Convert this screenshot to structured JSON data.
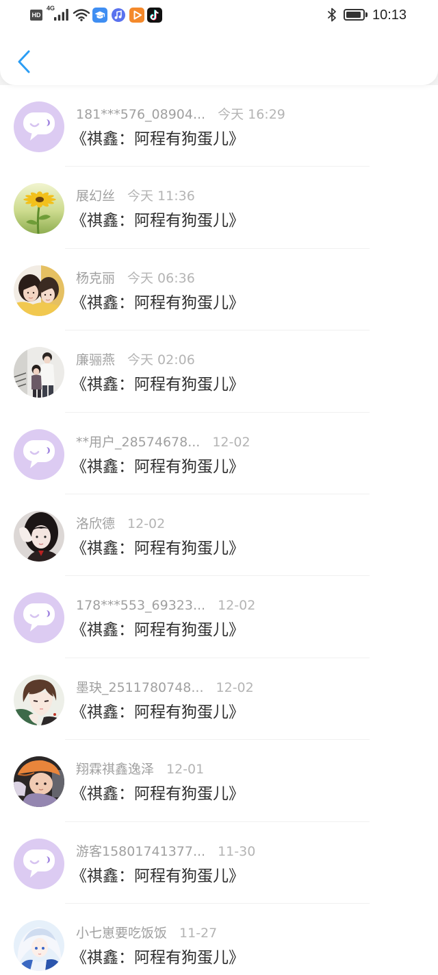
{
  "status_bar": {
    "network_badge": "HD",
    "network_type": "4G",
    "time": "10:13",
    "battery_level_percent": 90,
    "icons": [
      "signal-icon",
      "wifi-icon",
      "graduation-cap-app-icon",
      "music-app-icon",
      "play-app-icon",
      "tiktok-app-icon",
      "bluetooth-icon",
      "battery-icon"
    ]
  },
  "header": {
    "back_icon": "chevron-left-icon"
  },
  "theme": {
    "accent": "#2b9df4",
    "name_color": "#a0a0a0",
    "time_color": "#b4b4b4",
    "title_color": "#2e2e2e",
    "default_avatar_bg": "#dccbf2"
  },
  "list": {
    "items": [
      {
        "name": "181***576_08904...",
        "time": "今天 16:29",
        "title": "《祺鑫：阿程有狗蛋儿》",
        "avatar": "default-avatar-icon"
      },
      {
        "name": "展幻丝",
        "time": "今天 11:36",
        "title": "《祺鑫：阿程有狗蛋儿》",
        "avatar": "user-photo"
      },
      {
        "name": "杨克丽",
        "time": "今天 06:36",
        "title": "《祺鑫：阿程有狗蛋儿》",
        "avatar": "user-photo"
      },
      {
        "name": "廉骊燕",
        "time": "今天 02:06",
        "title": "《祺鑫：阿程有狗蛋儿》",
        "avatar": "user-photo"
      },
      {
        "name": "**用户_28574678...",
        "time": "12-02",
        "title": "《祺鑫：阿程有狗蛋儿》",
        "avatar": "default-avatar-icon"
      },
      {
        "name": "洛欣德",
        "time": "12-02",
        "title": "《祺鑫：阿程有狗蛋儿》",
        "avatar": "user-photo"
      },
      {
        "name": "178***553_69323...",
        "time": "12-02",
        "title": "《祺鑫：阿程有狗蛋儿》",
        "avatar": "default-avatar-icon"
      },
      {
        "name": "墨玦_2511780748...",
        "time": "12-02",
        "title": "《祺鑫：阿程有狗蛋儿》",
        "avatar": "user-photo"
      },
      {
        "name": "翔霖祺鑫逸泽",
        "time": "12-01",
        "title": "《祺鑫：阿程有狗蛋儿》",
        "avatar": "user-photo"
      },
      {
        "name": "游客15801741377...",
        "time": "11-30",
        "title": "《祺鑫：阿程有狗蛋儿》",
        "avatar": "default-avatar-icon"
      },
      {
        "name": "小七崽要吃饭饭",
        "time": "11-27",
        "title": "《祺鑫：阿程有狗蛋儿》",
        "avatar": "user-photo"
      }
    ]
  }
}
